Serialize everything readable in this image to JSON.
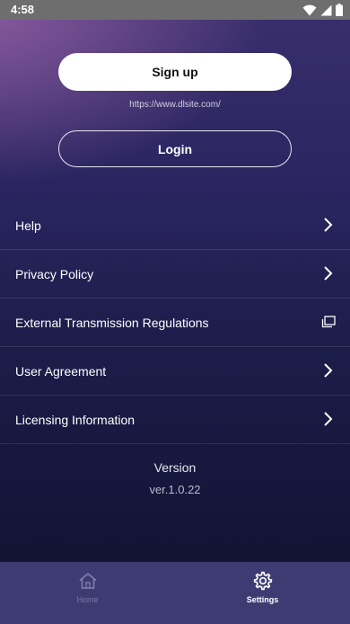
{
  "status_bar": {
    "time": "4:58"
  },
  "account": {
    "signup_label": "Sign up",
    "site_url": "https://www.dlsite.com/",
    "login_label": "Login"
  },
  "menu": {
    "items": [
      {
        "label": "Help",
        "icon": "chevron-right-icon"
      },
      {
        "label": "Privacy Policy",
        "icon": "chevron-right-icon"
      },
      {
        "label": "External Transmission Regulations",
        "icon": "external-window-icon"
      },
      {
        "label": "User Agreement",
        "icon": "chevron-right-icon"
      },
      {
        "label": "Licensing Information",
        "icon": "chevron-right-icon"
      }
    ]
  },
  "version": {
    "title": "Version",
    "value": "ver.1.0.22"
  },
  "bottom_nav": {
    "items": [
      {
        "label": "Home",
        "icon": "home-icon",
        "active": false
      },
      {
        "label": "Settings",
        "icon": "gear-icon",
        "active": true
      }
    ]
  },
  "colors": {
    "status_bar": "#6e6e6e",
    "nav_bar": "#3e3b73",
    "accent_text": "#ffffff",
    "inactive_nav": "#7b79a8"
  }
}
